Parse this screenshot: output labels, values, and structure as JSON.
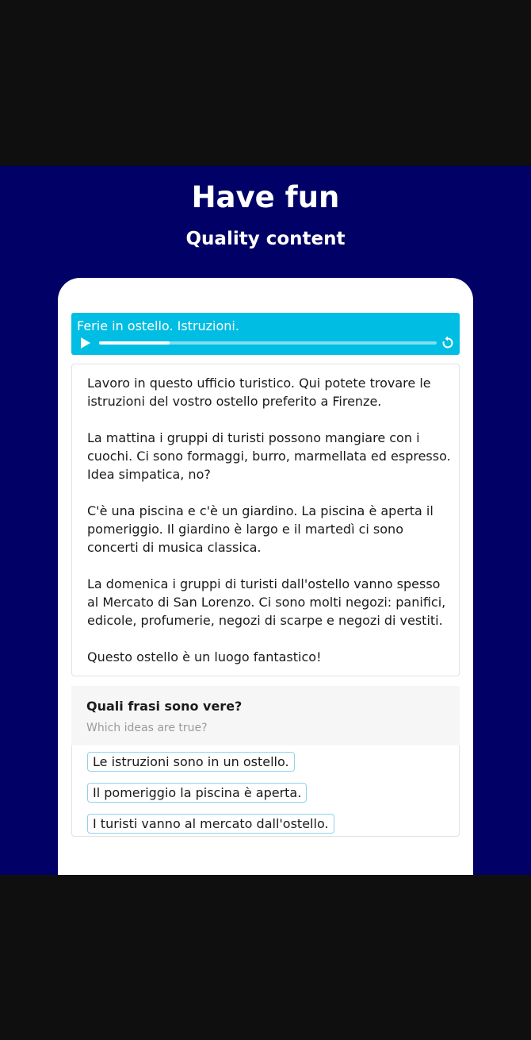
{
  "hero": {
    "title": "Have fun",
    "subtitle": "Quality content"
  },
  "player": {
    "title": "Ferie in ostello. Istruzioni.",
    "progress": 0.21,
    "play_icon": "play-icon",
    "replay_icon": "replay-icon"
  },
  "article": {
    "paragraphs": [
      "Lavoro in questo ufficio turistico. Qui potete trovare le istruzioni del vostro ostello preferito a Firenze.",
      "La mattina i gruppi di turisti possono mangiare con i cuochi. Ci sono formaggi, burro, marmellata ed espresso. Idea simpatica, no?",
      "C'è una piscina e c'è un giardino. La piscina è aperta il pomeriggio. Il giardino è largo e il martedì ci sono concerti di musica classica.",
      "La domenica i gruppi di turisti dall'ostello vanno spesso al Mercato di San Lorenzo. Ci sono molti negozi: panifici, edicole, profumerie, negozi di scarpe e negozi di vestiti.",
      "Questo ostello è un luogo fantastico!"
    ]
  },
  "question": {
    "title": "Quali frasi sono vere?",
    "subtitle": "Which ideas are true?",
    "options": [
      "Le istruzioni sono in un ostello.",
      "Il pomeriggio la piscina è aperta.",
      "I turisti vanno al mercato dall'ostello."
    ]
  },
  "colors": {
    "hero_bg": "#000066",
    "player_bg": "#00bde3",
    "option_border": "#8fd3ec"
  }
}
